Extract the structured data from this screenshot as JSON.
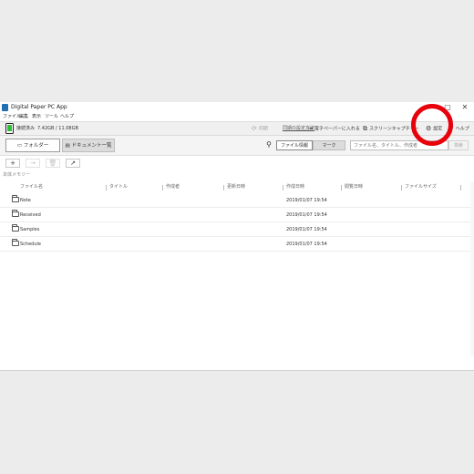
{
  "window": {
    "title": "Digital Paper PC App"
  },
  "titlebar": {
    "minimize": "–",
    "maximize": "▢",
    "close": "✕"
  },
  "menu": [
    "ファイル",
    "編集",
    "表示",
    "ツール",
    "ヘルプ"
  ],
  "device": {
    "status": "接続済み",
    "storage": "7.42GB / 11.08GB",
    "sync_label": "同期",
    "sync_settings": "同期の設定方法",
    "to_paper": "電子ペーパーに入れる",
    "screen_capture": "スクリーンキャプチャー",
    "settings": "設定",
    "help": "ヘルプ"
  },
  "view": {
    "tab_folder": "フォルダー",
    "tab_documents": "ドキュメント一覧",
    "segment_file_info": "ファイル情報",
    "segment_mark": "マーク",
    "search_placeholder": "ファイル名、タイトル、作成者",
    "search_button": "検索"
  },
  "actions": {
    "new_folder": "+",
    "import": "→",
    "delete": "🗑",
    "open_folder": "↗"
  },
  "location": "本体メモリー",
  "table": {
    "columns": [
      "ファイル名",
      "タイトル",
      "作成者",
      "更新日時",
      "作成日時",
      "閲覧日時",
      "ファイルサイズ"
    ],
    "rows": [
      {
        "name": "Note",
        "created": "2019/01/07 19:54"
      },
      {
        "name": "Received",
        "created": "2019/01/07 19:54"
      },
      {
        "name": "Samples",
        "created": "2019/01/07 19:54"
      },
      {
        "name": "Schedule",
        "created": "2019/01/07 19:54"
      }
    ]
  },
  "colors": {
    "highlight": "#e8000b",
    "battery": "#2fc03a",
    "app_icon": "#1f6fb2"
  }
}
